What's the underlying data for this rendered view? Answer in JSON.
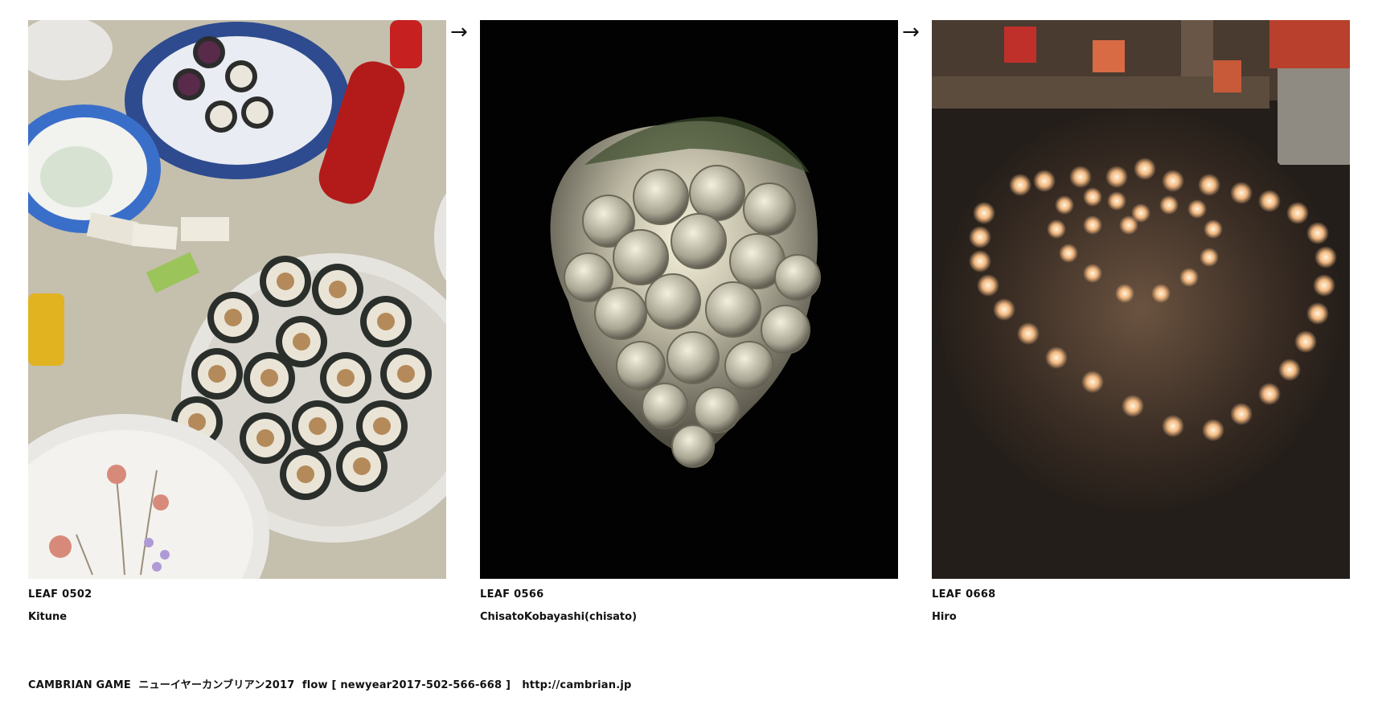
{
  "leaves": [
    {
      "id": "LEAF 0502",
      "author": "Kitune",
      "photo_subject": "sushi-rolls-photo"
    },
    {
      "id": "LEAF 0566",
      "author": "ChisatoKobayashi(chisato)",
      "photo_subject": "glowing-grape-lamp-photo"
    },
    {
      "id": "LEAF 0668",
      "author": "Hiro",
      "photo_subject": "candle-heart-photo"
    }
  ],
  "arrow_glyph": "→",
  "footer": {
    "text": "CAMBRIAN GAME  ニューイヤーカンブリアン2017  flow [ newyear2017-502-566-668 ]   ",
    "link": "http://cambrian.jp"
  }
}
